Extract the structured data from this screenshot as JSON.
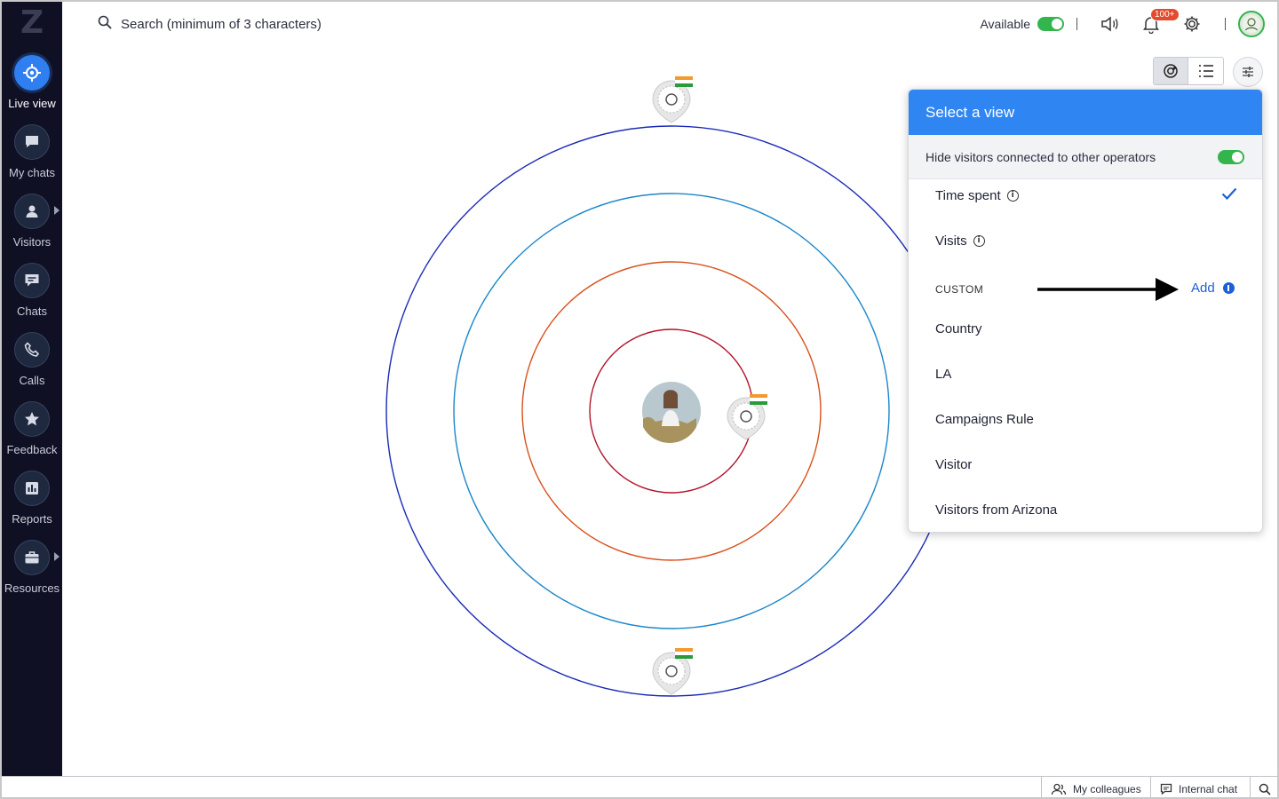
{
  "app": {
    "logo_text": "Z"
  },
  "sidebar": {
    "items": [
      {
        "label": "Live view",
        "icon": "crosshair-icon"
      },
      {
        "label": "My chats",
        "icon": "chat-bubble-icon"
      },
      {
        "label": "Visitors",
        "icon": "person-icon"
      },
      {
        "label": "Chats",
        "icon": "chat-lines-icon"
      },
      {
        "label": "Calls",
        "icon": "phone-icon"
      },
      {
        "label": "Feedback",
        "icon": "star-icon"
      },
      {
        "label": "Reports",
        "icon": "bar-chart-icon"
      },
      {
        "label": "Resources",
        "icon": "briefcase-icon"
      }
    ]
  },
  "topbar": {
    "search_placeholder": "Search (minimum of 3 characters)",
    "status_label": "Available",
    "notification_badge": "100+"
  },
  "view_panel": {
    "title": "Select a view",
    "hide_label": "Hide visitors connected to other operators",
    "options": {
      "time_spent": "Time spent",
      "visits": "Visits"
    },
    "custom_section": "CUSTOM",
    "add_label": "Add",
    "custom_items": [
      "Country",
      "LA",
      "Campaigns Rule",
      "Visitor",
      "Visitors from Arizona"
    ]
  },
  "bottombar": {
    "colleagues": "My colleagues",
    "internal_chat": "Internal chat"
  },
  "colors": {
    "accent": "#2f86f2",
    "sidebar": "#0f1024",
    "toggle_on": "#32b54c",
    "link": "#1d5fd6"
  }
}
